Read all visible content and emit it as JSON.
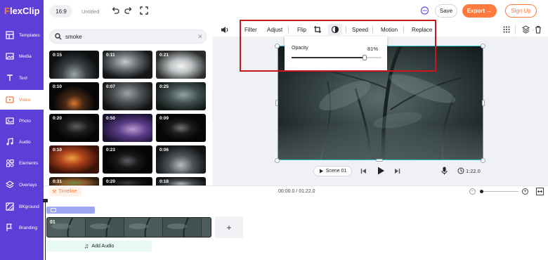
{
  "brand": {
    "logo_f": "F",
    "logo_rest": "lexClip",
    "accent": "#ff7a3d",
    "sidebar_color": "#5b3fd6",
    "highlight": "#c9161d"
  },
  "sidebar": {
    "items": [
      {
        "label": "Templates",
        "icon": "templates-icon"
      },
      {
        "label": "Media",
        "icon": "media-icon"
      },
      {
        "label": "Text",
        "icon": "text-icon"
      },
      {
        "label": "Video",
        "icon": "video-icon",
        "active": true
      },
      {
        "label": "Photo",
        "icon": "photo-icon"
      },
      {
        "label": "Audio",
        "icon": "audio-icon"
      },
      {
        "label": "Elements",
        "icon": "elements-icon"
      },
      {
        "label": "Overlays",
        "icon": "overlays-icon"
      },
      {
        "label": "BKground",
        "icon": "background-icon"
      },
      {
        "label": "Branding",
        "icon": "branding-icon"
      }
    ]
  },
  "header": {
    "ratio": "16:9",
    "title": "Untitled",
    "save_label": "Save",
    "export_label": "Export →",
    "signup_label": "Sign Up"
  },
  "search": {
    "value": "smoke"
  },
  "thumbnails": [
    {
      "duration": "0:15"
    },
    {
      "duration": "0:11"
    },
    {
      "duration": "0:21"
    },
    {
      "duration": "0:10"
    },
    {
      "duration": "0:07"
    },
    {
      "duration": "0:25"
    },
    {
      "duration": "0:20"
    },
    {
      "duration": "0:50"
    },
    {
      "duration": "0:09"
    },
    {
      "duration": "0:10"
    },
    {
      "duration": "0:23"
    },
    {
      "duration": "0:06"
    },
    {
      "duration": "0:31"
    },
    {
      "duration": "0:20"
    },
    {
      "duration": "0:18"
    }
  ],
  "toolbar": {
    "filter": "Filter",
    "adjust": "Adjust",
    "flip": "Flip",
    "speed": "Speed",
    "motion": "Motion",
    "replace": "Replace"
  },
  "opacity": {
    "label": "Opacity",
    "value_text": "81%",
    "value": 0.81
  },
  "player": {
    "scene_label": "Scene 01",
    "duration": "1:22.0"
  },
  "timeline": {
    "label": "Timeline",
    "time": "00:00.0 / 01:22.0",
    "clip_label": "01",
    "add_audio": "Add Audio",
    "add_scene": "+"
  }
}
